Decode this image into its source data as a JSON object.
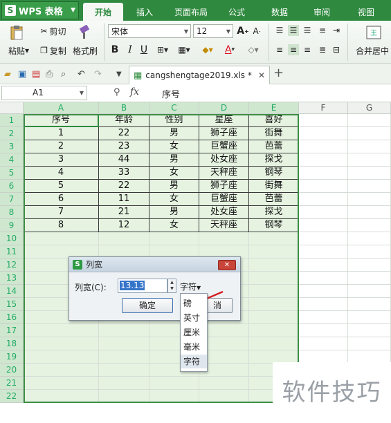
{
  "app": {
    "title": "WPS 表格",
    "logo": "S"
  },
  "ribbon_tabs": [
    "开始",
    "插入",
    "页面布局",
    "公式",
    "数据",
    "审阅",
    "视图"
  ],
  "ribbon": {
    "paste": "粘贴",
    "cut": "剪切",
    "copy": "复制",
    "format_painter": "格式刷",
    "font_name": "宋体",
    "font_size": "12",
    "bold": "B",
    "italic": "I",
    "underline": "U",
    "font_color_label": "A",
    "merge_center": "合并居中"
  },
  "file_tab": {
    "name": "cangshengtage2019.xls *"
  },
  "formula_bar": {
    "cell_ref": "A1",
    "fx": "fx",
    "content": "序号"
  },
  "columns": [
    "A",
    "B",
    "C",
    "D",
    "E",
    "F",
    "G"
  ],
  "rows": [
    "1",
    "2",
    "3",
    "4",
    "5",
    "6",
    "7",
    "8",
    "9",
    "10",
    "11",
    "12",
    "13",
    "14",
    "15",
    "16",
    "17",
    "18",
    "19",
    "20",
    "21",
    "22"
  ],
  "table": {
    "header": [
      "序号",
      "年龄",
      "性别",
      "星座",
      "喜好"
    ],
    "rows": [
      [
        "1",
        "22",
        "男",
        "狮子座",
        "街舞"
      ],
      [
        "2",
        "23",
        "女",
        "巨蟹座",
        "芭蕾"
      ],
      [
        "3",
        "44",
        "男",
        "处女座",
        "探戈"
      ],
      [
        "4",
        "33",
        "女",
        "天秤座",
        "钢琴"
      ],
      [
        "5",
        "22",
        "男",
        "狮子座",
        "街舞"
      ],
      [
        "6",
        "11",
        "女",
        "巨蟹座",
        "芭蕾"
      ],
      [
        "7",
        "21",
        "男",
        "处女座",
        "探戈"
      ],
      [
        "8",
        "12",
        "女",
        "天秤座",
        "钢琴"
      ]
    ]
  },
  "dialog": {
    "title": "列宽",
    "label": "列宽(C):",
    "value": "13.13",
    "unit": "字符",
    "ok": "确定",
    "cancel": "消"
  },
  "unit_options": [
    "磅",
    "英寸",
    "厘米",
    "毫米",
    "字符"
  ],
  "selected_unit": "字符",
  "watermark": "软件技巧",
  "colors": {
    "accent": "#2f8a3f",
    "selection": "#e6f3e1",
    "arrow": "#d42020"
  }
}
